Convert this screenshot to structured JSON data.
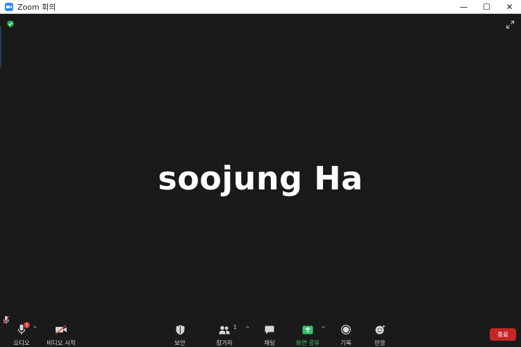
{
  "window": {
    "title": "Zoom 회의",
    "minimize_glyph": "—",
    "maximize_glyph": "☐",
    "close_glyph": "✕"
  },
  "video": {
    "participant_name": "soojung Ha"
  },
  "toolbar": {
    "audio_label": "오디오",
    "audio_badge": "!",
    "video_label": "비디오 시작",
    "security_label": "보안",
    "participants_label": "참가자",
    "participants_count": "1",
    "chat_label": "채팅",
    "share_label": "화면 공유",
    "record_label": "기록",
    "reactions_label": "반응",
    "end_label": "종료"
  },
  "colors": {
    "background": "#1a1a1a",
    "share_green": "#36c36b",
    "end_red": "#c72626",
    "zoom_blue": "#2d8cff"
  },
  "icons": {
    "app": "zoom-app-icon",
    "security_top": "shield-check-icon",
    "fullscreen": "fullscreen-icon",
    "audio": "microphone-icon",
    "video": "video-off-icon",
    "security": "shield-icon",
    "participants": "people-icon",
    "chat": "chat-bubble-icon",
    "share": "share-screen-icon",
    "record": "record-icon",
    "reactions": "emoji-icon"
  }
}
